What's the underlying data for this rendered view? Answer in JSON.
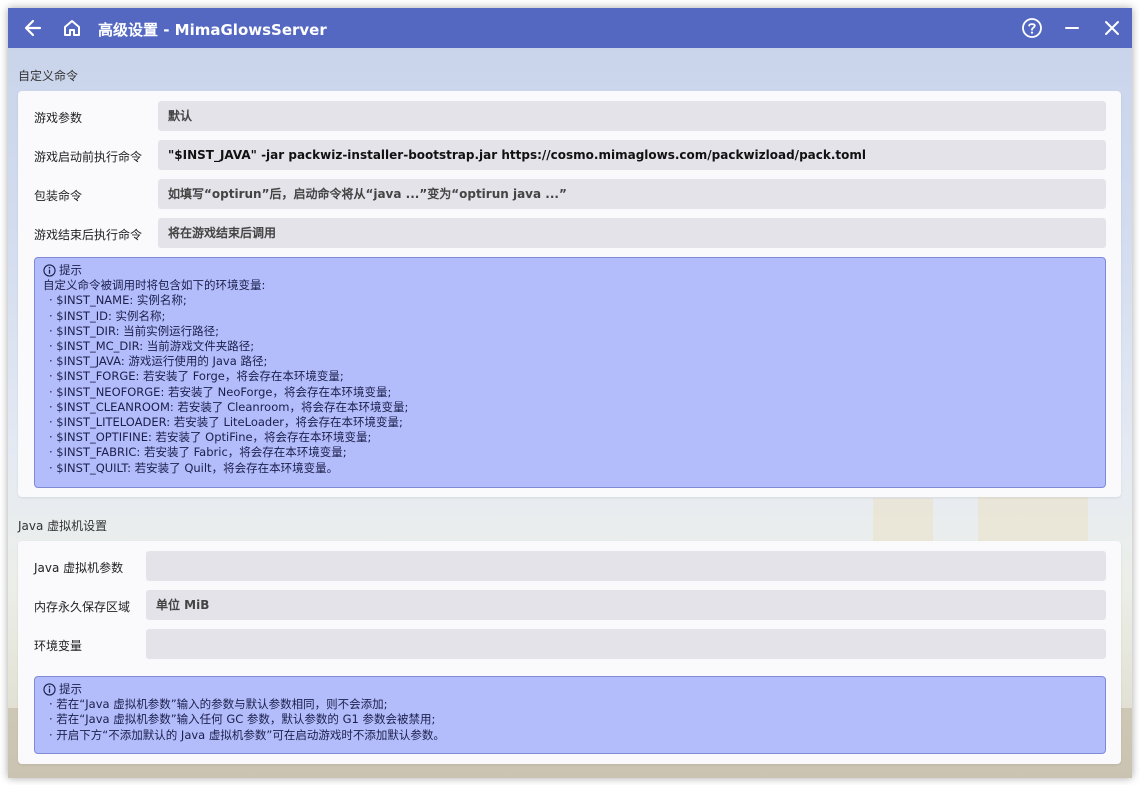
{
  "window": {
    "title": "高级设置 - MimaGlowsServer",
    "icons": {
      "back": "arrow-left-icon",
      "home": "home-icon",
      "help": "help-circle-icon",
      "minimize": "minimize-icon",
      "close": "close-icon"
    }
  },
  "custom_commands": {
    "section_title": "自定义命令",
    "rows": [
      {
        "label": "游戏参数",
        "value": "默认",
        "is_placeholder": true
      },
      {
        "label": "游戏启动前执行命令",
        "value": "\"$INST_JAVA\" -jar packwiz-installer-bootstrap.jar https://cosmo.mimaglows.com/packwizload/pack.toml",
        "is_placeholder": false
      },
      {
        "label": "包装命令",
        "value": "如填写“optirun”后，启动命令将从“java ...”变为“optirun java ...”",
        "is_placeholder": true
      },
      {
        "label": "游戏结束后执行命令",
        "value": "将在游戏结束后调用",
        "is_placeholder": true
      }
    ],
    "hint": {
      "title": "提示",
      "intro": "自定义命令被调用时将包含如下的环境变量:",
      "items": [
        "· $INST_NAME: 实例名称;",
        "· $INST_ID: 实例名称;",
        "· $INST_DIR: 当前实例运行路径;",
        "· $INST_MC_DIR: 当前游戏文件夹路径;",
        "· $INST_JAVA: 游戏运行使用的 Java 路径;",
        "· $INST_FORGE: 若安装了 Forge，将会存在本环境变量;",
        "· $INST_NEOFORGE: 若安装了 NeoForge，将会存在本环境变量;",
        "· $INST_CLEANROOM: 若安装了 Cleanroom，将会存在本环境变量;",
        "· $INST_LITELOADER: 若安装了 LiteLoader，将会存在本环境变量;",
        "· $INST_OPTIFINE: 若安装了 OptiFine，将会存在本环境变量;",
        "· $INST_FABRIC: 若安装了 Fabric，将会存在本环境变量;",
        "· $INST_QUILT: 若安装了 Quilt，将会存在本环境变量。"
      ]
    }
  },
  "jvm": {
    "section_title": "Java 虚拟机设置",
    "rows": [
      {
        "label": "Java 虚拟机参数",
        "value": "",
        "is_placeholder": true
      },
      {
        "label": "内存永久保存区域",
        "value": "单位 MiB",
        "is_placeholder": true
      },
      {
        "label": "环境变量",
        "value": "",
        "is_placeholder": true
      }
    ],
    "hint": {
      "title": "提示",
      "items": [
        "· 若在“Java 虚拟机参数”输入的参数与默认参数相同，则不会添加;",
        "· 若在“Java 虚拟机参数”输入任何 GC 参数，默认参数的 G1 参数会被禁用;",
        "· 开启下方“不添加默认的 Java 虚拟机参数”可在启动游戏时不添加默认参数。"
      ]
    }
  },
  "colors": {
    "titlebar": "#5468c2",
    "hint_bg": "#b4bdfc",
    "hint_border": "#7e8ad6",
    "field_bg": "#e4e3ea"
  }
}
